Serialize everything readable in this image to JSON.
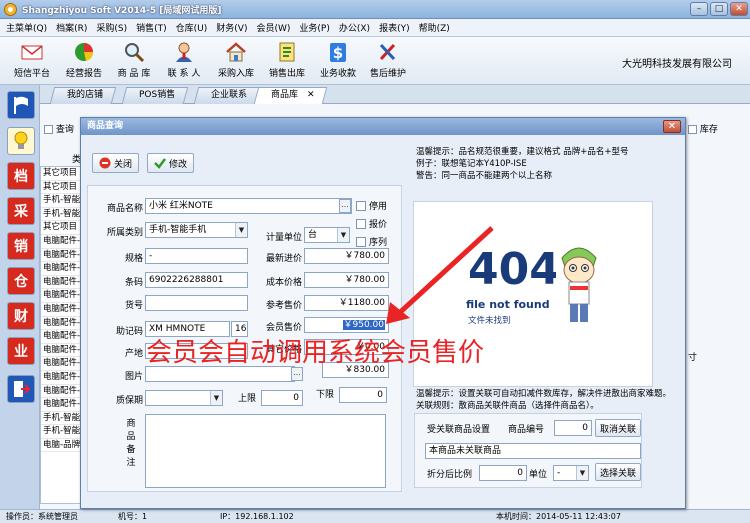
{
  "app": {
    "title": "Shangzhiyou Soft V2014-5 [局域网试用版]",
    "company": "大光明科技发展有限公司"
  },
  "menu": [
    "主菜单(Q)",
    "档案(R)",
    "采购(S)",
    "销售(T)",
    "仓库(U)",
    "财务(V)",
    "会员(W)",
    "业务(P)",
    "办公(X)",
    "报表(Y)",
    "帮助(Z)"
  ],
  "toolbar": [
    {
      "label": "短信平台",
      "icon": "envelope-icon"
    },
    {
      "label": "经营报告",
      "icon": "pie-chart-icon"
    },
    {
      "label": "商 品 库",
      "icon": "magnifier-icon"
    },
    {
      "label": "联 系 人",
      "icon": "contact-person-icon"
    },
    {
      "label": "采购入库",
      "icon": "house-icon"
    },
    {
      "label": "销售出库",
      "icon": "ledger-icon"
    },
    {
      "label": "业务收款",
      "icon": "dollar-icon"
    },
    {
      "label": "售后维护",
      "icon": "tools-icon"
    }
  ],
  "sidebar": [
    "flag-icon",
    "bulb-icon",
    "档",
    "采",
    "销",
    "仓",
    "财",
    "业",
    "exit-icon"
  ],
  "tabs": [
    "我的店铺",
    "POS销售",
    "企业联系",
    "商品库"
  ],
  "tab_close": "✕",
  "background": {
    "filter_label": "查询",
    "stock_label": "库存",
    "header_label": "类",
    "side_text": "寸",
    "rows": [
      "其它项目",
      "其它项目",
      "手机-智能",
      "手机-智能",
      "其它项目",
      "电脑配件-",
      "电脑配件-",
      "电脑配件-",
      "电脑配件-",
      "电脑配件-",
      "电脑配件-",
      "电脑配件-",
      "电脑配件-",
      "电脑配件-",
      "电脑配件-",
      "电脑配件-",
      "电脑配件-",
      "电脑配件-",
      "手机-智能",
      "手机-智能",
      "电脑-品牌"
    ]
  },
  "statusbar": {
    "operator": "操作员：系统管理员",
    "machine": "机号：1",
    "ip": "IP：192.168.1.102",
    "time": "本机时间：2014-05-11 12:43:07"
  },
  "dialog": {
    "title": "商品查询",
    "close_label": "关闭",
    "edit_label": "修改",
    "tips": [
      "温馨提示：品名规范很重要，建议格式  品牌+品名+型号",
      "例子：联想笔记本Y410P-ISE",
      "警告：同一商品不能建两个以上名称"
    ],
    "fields": {
      "name_label": "商品名称",
      "name_value": "小米 红米NOTE",
      "category_label": "所属类别",
      "category_value": "手机-智能手机",
      "spec_label": "规格",
      "spec_value": "-",
      "barcode_label": "条码",
      "barcode_value": "6902226288801",
      "itemno_label": "货号",
      "itemno_value": "",
      "mnemonic_label": "助记码",
      "mnemonic_value": "XM HMNOTE",
      "mnemonic_len": "16",
      "origin_label": "产地",
      "image_label": "图片",
      "shelf_label": "质保期",
      "upper_label": "上限",
      "upper_value": "0",
      "lower_label": "下限",
      "lower_value": "0",
      "remark_label_1": "商",
      "remark_label_2": "品",
      "remark_label_3": "备",
      "remark_label_4": "注",
      "unit_label": "计量单位",
      "unit_value": "台",
      "latest_in_label": "最新进价",
      "latest_in_value": "￥780.00",
      "cost_label": "成本价格",
      "cost_value": "￥780.00",
      "ref_price_label": "参考售价",
      "ref_price_value": "￥1180.00",
      "member_price_label": "会员售价",
      "member_price_value": "￥950.00",
      "other_price_label": "其它价格",
      "other_price_value": "￥0.00",
      "hidden_price_value": "￥830.00",
      "discontinued_label": "停用",
      "tax_label": "报价",
      "serial_label": "序列"
    },
    "image": {
      "code": "404",
      "caption": "file not found",
      "cn_caption": "文件未找到"
    },
    "overlay": "会员会自动调用系统会员售价",
    "link": {
      "tip": "温馨提示：设置关联可自动扣减件数库存，解决件进散出商家难题。关联规则：散商品关联件商品（选择件商品名）。",
      "setup_label": "受关联商品设置",
      "code_label": "商品编号",
      "code_value": "0",
      "cancel_label": "取消关联",
      "status_value": "本商品未关联商品",
      "ratio_label": "折分后比例",
      "ratio_value": "0",
      "unit_label": "单位",
      "unit_value": "-",
      "select_label": "选择关联"
    }
  },
  "colors": {
    "accent": "#3168c5",
    "annotation": "#ea2424"
  }
}
